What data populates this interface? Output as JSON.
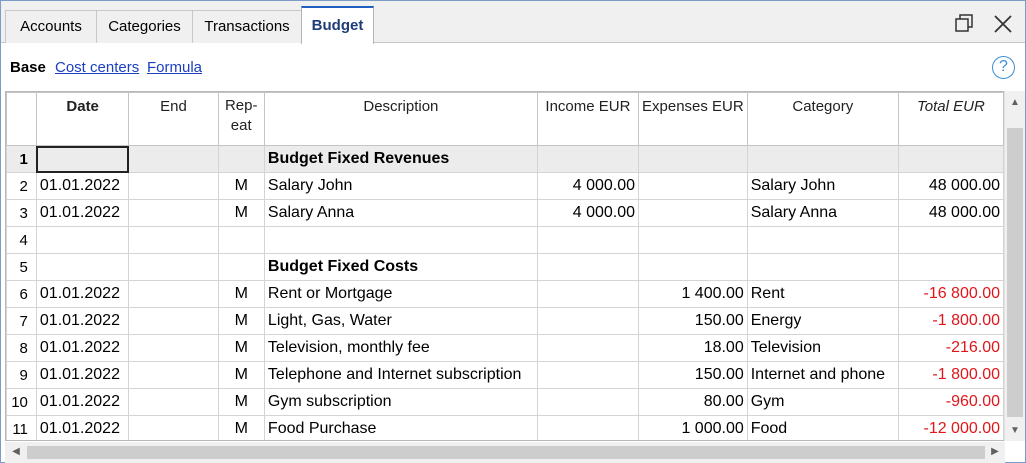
{
  "tabs": {
    "accounts": "Accounts",
    "categories": "Categories",
    "transactions": "Transactions",
    "budget": "Budget"
  },
  "subtabs": {
    "base": "Base",
    "cost_centers": "Cost centers",
    "formula": "Formula"
  },
  "help": "?",
  "columns": {
    "date": "Date",
    "end": "End",
    "repeat": "Rep-\neat",
    "description": "Description",
    "income": "Income EUR",
    "expenses": "Expenses EUR",
    "category": "Category",
    "total": "Total EUR"
  },
  "rows": [
    {
      "num": "1",
      "date": "",
      "end": "",
      "repeat": "",
      "description": "Budget Fixed Revenues",
      "income": "",
      "expenses": "",
      "category": "",
      "total": "",
      "header": true
    },
    {
      "num": "2",
      "date": "01.01.2022",
      "end": "",
      "repeat": "M",
      "description": "Salary John",
      "income": "4 000.00",
      "expenses": "",
      "category": "Salary John",
      "total": "48 000.00"
    },
    {
      "num": "3",
      "date": "01.01.2022",
      "end": "",
      "repeat": "M",
      "description": "Salary Anna",
      "income": "4 000.00",
      "expenses": "",
      "category": "Salary Anna",
      "total": "48 000.00"
    },
    {
      "num": "4",
      "date": "",
      "end": "",
      "repeat": "",
      "description": "",
      "income": "",
      "expenses": "",
      "category": "",
      "total": ""
    },
    {
      "num": "5",
      "date": "",
      "end": "",
      "repeat": "",
      "description": "Budget Fixed Costs",
      "income": "",
      "expenses": "",
      "category": "",
      "total": "",
      "bold": true
    },
    {
      "num": "6",
      "date": "01.01.2022",
      "end": "",
      "repeat": "M",
      "description": "Rent or Mortgage",
      "income": "",
      "expenses": "1 400.00",
      "category": "Rent",
      "total": "-16 800.00"
    },
    {
      "num": "7",
      "date": "01.01.2022",
      "end": "",
      "repeat": "M",
      "description": "Light, Gas, Water",
      "income": "",
      "expenses": "150.00",
      "category": "Energy",
      "total": "-1 800.00"
    },
    {
      "num": "8",
      "date": "01.01.2022",
      "end": "",
      "repeat": "M",
      "description": "Television, monthly fee",
      "income": "",
      "expenses": "18.00",
      "category": "Television",
      "total": "-216.00"
    },
    {
      "num": "9",
      "date": "01.01.2022",
      "end": "",
      "repeat": "M",
      "description": "Telephone and Internet subscription",
      "income": "",
      "expenses": "150.00",
      "category": "Internet and phone",
      "total": "-1 800.00"
    },
    {
      "num": "10",
      "date": "01.01.2022",
      "end": "",
      "repeat": "M",
      "description": "Gym subscription",
      "income": "",
      "expenses": "80.00",
      "category": "Gym",
      "total": "-960.00"
    },
    {
      "num": "11",
      "date": "01.01.2022",
      "end": "",
      "repeat": "M",
      "description": "Food Purchase",
      "income": "",
      "expenses": "1 000.00",
      "category": "Food",
      "total": "-12 000.00"
    }
  ],
  "colors": {
    "negative": "#e0161b",
    "link": "#1a3fbf",
    "active_tab_text": "#1f3c78",
    "help_icon": "#3c8fd6"
  }
}
